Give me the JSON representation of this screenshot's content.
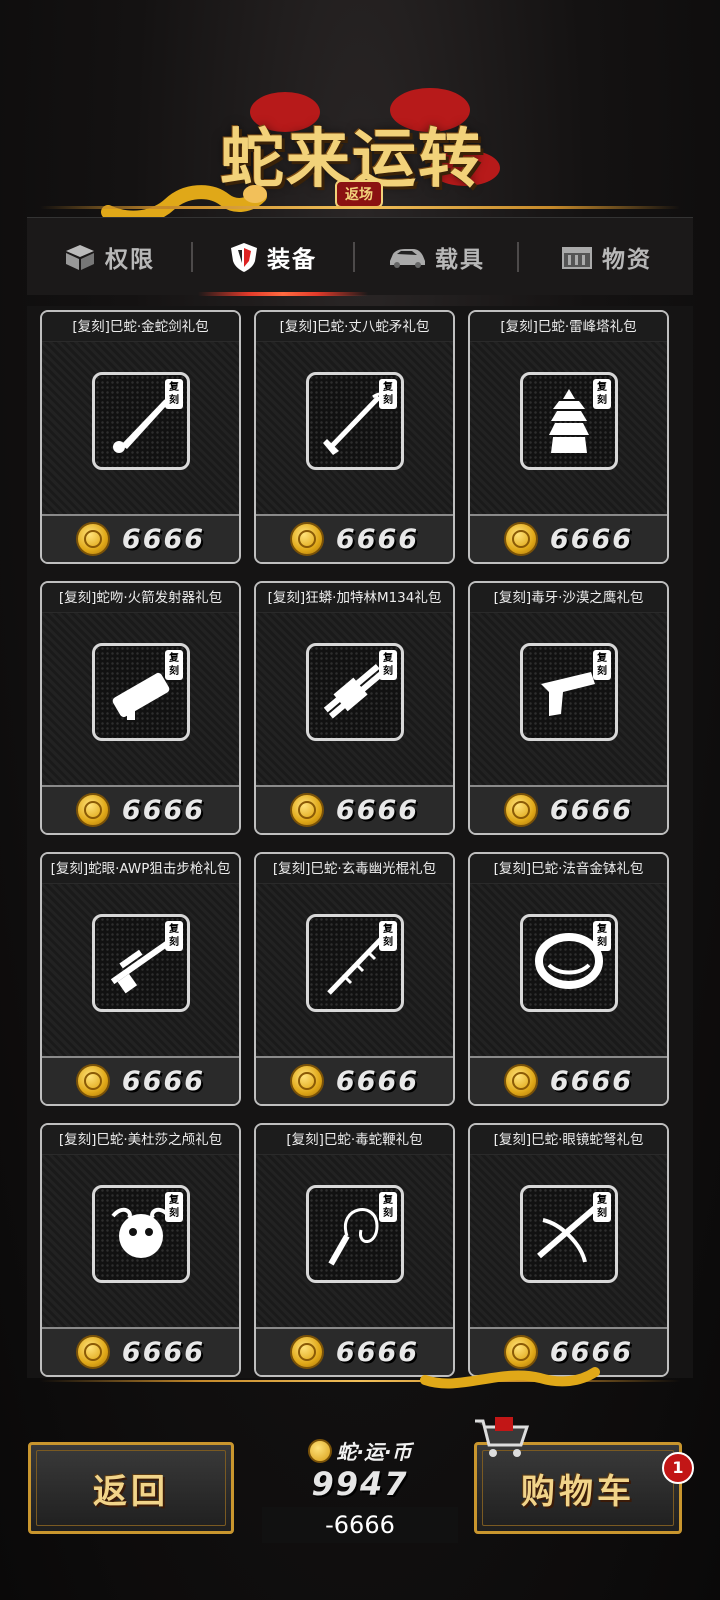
{
  "banner": {
    "title": "蛇来运转",
    "subtitle": "返场"
  },
  "tabs": [
    {
      "label": "权限",
      "icon": "box-icon",
      "active": false
    },
    {
      "label": "装备",
      "icon": "shield-icon",
      "active": true
    },
    {
      "label": "载具",
      "icon": "car-icon",
      "active": false
    },
    {
      "label": "物资",
      "icon": "crate-icon",
      "active": false
    }
  ],
  "tag_label": "复刻",
  "items": [
    {
      "name": "[复刻]巳蛇·金蛇剑礼包",
      "price": "6666",
      "icon": "sword-icon"
    },
    {
      "name": "[复刻]巳蛇·丈八蛇矛礼包",
      "price": "6666",
      "icon": "spear-icon"
    },
    {
      "name": "[复刻]巳蛇·雷峰塔礼包",
      "price": "6666",
      "icon": "pagoda-icon"
    },
    {
      "name": "[复刻]蛇吻·火箭发射器礼包",
      "price": "6666",
      "icon": "rocket-launcher-icon"
    },
    {
      "name": "[复刻]狂蟒·加特林M134礼包",
      "price": "6666",
      "icon": "gatling-icon"
    },
    {
      "name": "[复刻]毒牙·沙漠之鹰礼包",
      "price": "6666",
      "icon": "pistol-icon"
    },
    {
      "name": "[复刻]蛇眼·AWP狙击步枪礼包",
      "price": "6666",
      "icon": "sniper-icon"
    },
    {
      "name": "[复刻]巳蛇·玄毒幽光棍礼包",
      "price": "6666",
      "icon": "staff-icon"
    },
    {
      "name": "[复刻]巳蛇·法音金钵礼包",
      "price": "6666",
      "icon": "bowl-icon"
    },
    {
      "name": "[复刻]巳蛇·美杜莎之颅礼包",
      "price": "6666",
      "icon": "medusa-icon"
    },
    {
      "name": "[复刻]巳蛇·毒蛇鞭礼包",
      "price": "6666",
      "icon": "whip-icon"
    },
    {
      "name": "[复刻]巳蛇·眼镜蛇弩礼包",
      "price": "6666",
      "icon": "crossbow-icon"
    }
  ],
  "bottom": {
    "back_label": "返回",
    "cart_label": "购物车",
    "cart_badge": "1",
    "wallet_title": "蛇·运·币",
    "wallet_amount": "9947",
    "wallet_cost": "-6666"
  },
  "colors": {
    "gold": "#f2d27a",
    "accent_red": "#c21616",
    "card_border": "#bfbfbf"
  }
}
